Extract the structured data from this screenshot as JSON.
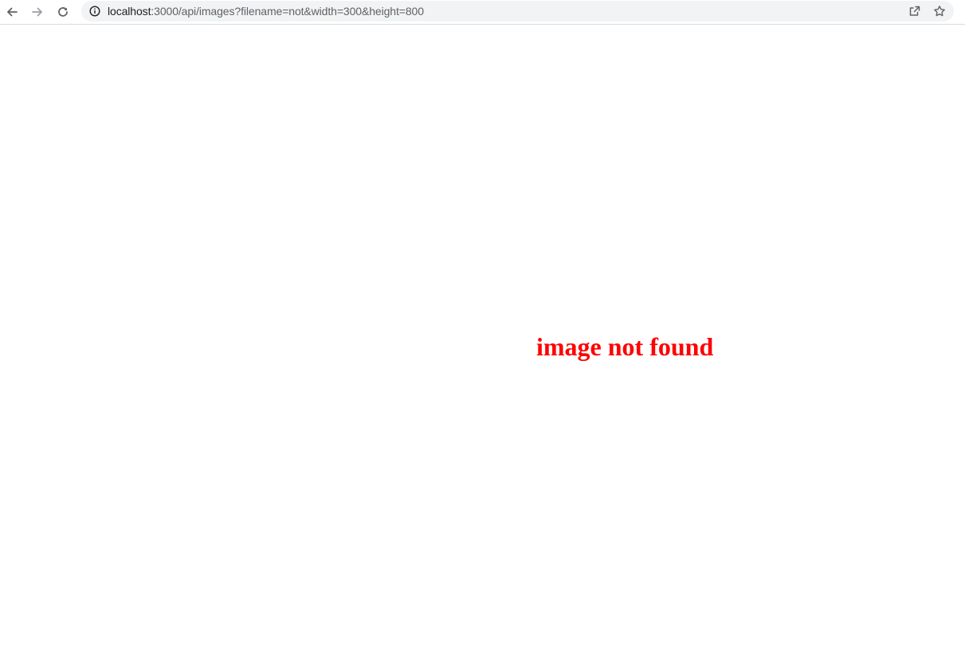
{
  "browser": {
    "url_host": "localhost",
    "url_rest": ":3000/api/images?filename=not&width=300&height=800",
    "icons": {
      "back": "arrow-left-icon",
      "forward": "arrow-right-icon",
      "reload": "reload-icon",
      "site_info": "info-icon",
      "share": "share-icon",
      "bookmark": "star-icon"
    }
  },
  "page": {
    "message": "image not found",
    "message_color": "#ff0000"
  }
}
